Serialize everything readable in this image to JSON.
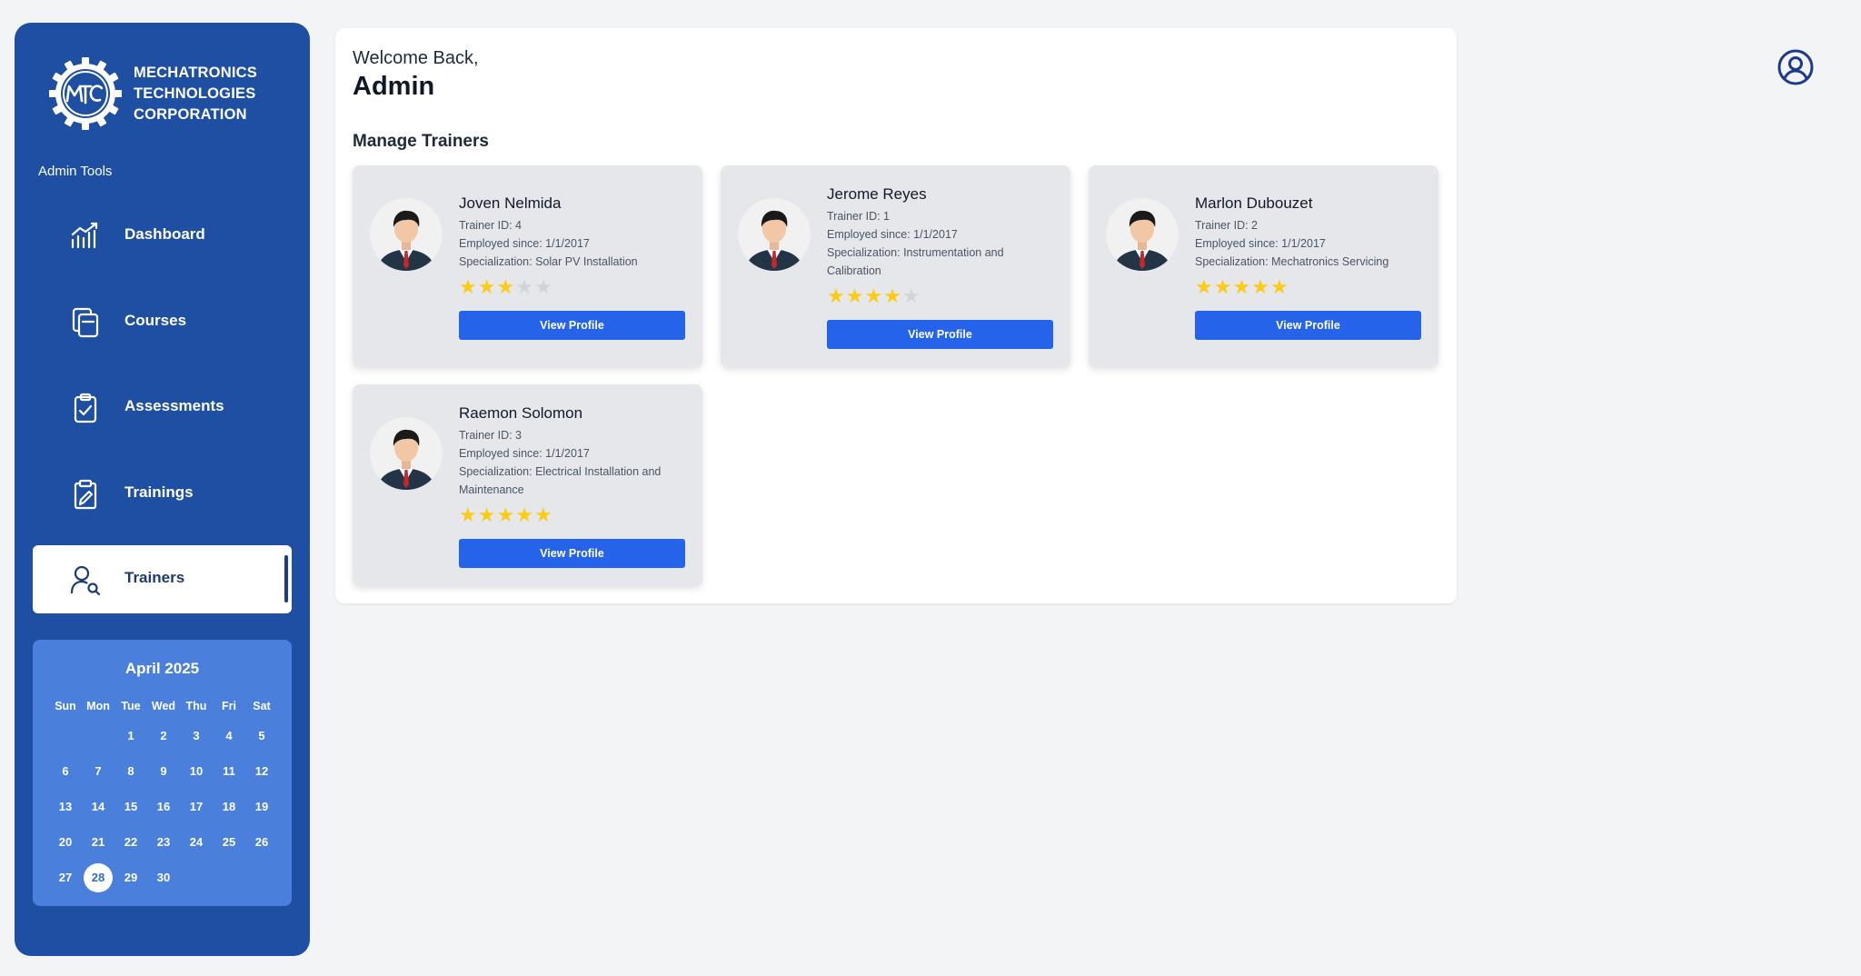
{
  "brand": {
    "line1": "MECHATRONICS",
    "line2": "TECHNOLOGIES",
    "line3": "CORPORATION",
    "logo_text": "MTC"
  },
  "sidebar": {
    "section_label": "Admin Tools",
    "items": [
      {
        "label": "Dashboard",
        "icon": "chart-icon"
      },
      {
        "label": "Courses",
        "icon": "copy-icon"
      },
      {
        "label": "Assessments",
        "icon": "clipboard-check-icon"
      },
      {
        "label": "Trainings",
        "icon": "clipboard-edit-icon"
      },
      {
        "label": "Trainers",
        "icon": "user-search-icon",
        "active": true
      }
    ]
  },
  "calendar": {
    "title": "April 2025",
    "weekdays": [
      "Sun",
      "Mon",
      "Tue",
      "Wed",
      "Thu",
      "Fri",
      "Sat"
    ],
    "first_weekday_index": 2,
    "days_in_month": 30,
    "today": 28
  },
  "main": {
    "welcome": "Welcome Back,",
    "user": "Admin",
    "section_title": "Manage Trainers"
  },
  "trainers": [
    {
      "name": "Joven Nelmida",
      "id_text": "Trainer ID: 4",
      "employed_text": "Employed since: 1/1/2017",
      "spec_text": "Specialization: Solar PV Installation",
      "rating": 3,
      "button": "View Profile"
    },
    {
      "name": "Jerome Reyes",
      "id_text": "Trainer ID: 1",
      "employed_text": "Employed since: 1/1/2017",
      "spec_text": "Specialization: Instrumentation and Calibration",
      "rating": 4,
      "button": "View Profile"
    },
    {
      "name": "Marlon Dubouzet",
      "id_text": "Trainer ID: 2",
      "employed_text": "Employed since: 1/1/2017",
      "spec_text": "Specialization: Mechatronics Servicing",
      "rating": 5,
      "button": "View Profile"
    },
    {
      "name": "Raemon Solomon",
      "id_text": "Trainer ID: 3",
      "employed_text": "Employed since: 1/1/2017",
      "spec_text": "Specialization: Electrical Installation and Maintenance",
      "rating": 5,
      "button": "View Profile"
    }
  ],
  "header": {
    "account_icon": "user-circle-icon"
  },
  "colors": {
    "sidebar": "#1e4fa3",
    "calendar": "#4a80dc",
    "button": "#2563eb",
    "star": "#facc15"
  }
}
